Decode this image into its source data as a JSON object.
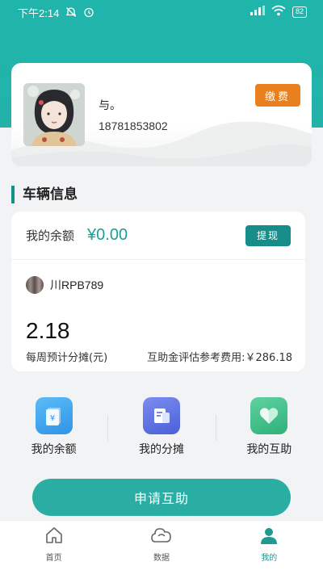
{
  "status_bar": {
    "time": "下午2:14",
    "battery": "82"
  },
  "profile": {
    "name": "与。",
    "phone": "18781853802",
    "pay_button": "缴费"
  },
  "section": {
    "title": "车辆信息"
  },
  "vehicle": {
    "balance_label": "我的余额",
    "balance_value": "¥0.00",
    "withdraw_button": "提现",
    "plate": "川RPB789",
    "weekly_value": "2.18",
    "weekly_label": "每周预计分摊(元)",
    "reference_fee": "互助金评估参考费用:￥286.18"
  },
  "quick_actions": [
    {
      "label": "我的余额",
      "icon": "wallet-icon",
      "color": "#3fa6f0"
    },
    {
      "label": "我的分摊",
      "icon": "document-icon",
      "color": "#5a6fe0"
    },
    {
      "label": "我的互助",
      "icon": "heart-icon",
      "color": "#3cc08a"
    }
  ],
  "apply_button": "申请互助",
  "tabbar": {
    "items": [
      {
        "label": "首页",
        "icon": "home-icon"
      },
      {
        "label": "数据",
        "icon": "cloud-icon"
      },
      {
        "label": "我的",
        "icon": "user-icon"
      }
    ],
    "active": "我的"
  },
  "colors": {
    "brand": "#1fb5ab",
    "accent_orange": "#e8801e",
    "button_teal": "#2aaea4"
  }
}
